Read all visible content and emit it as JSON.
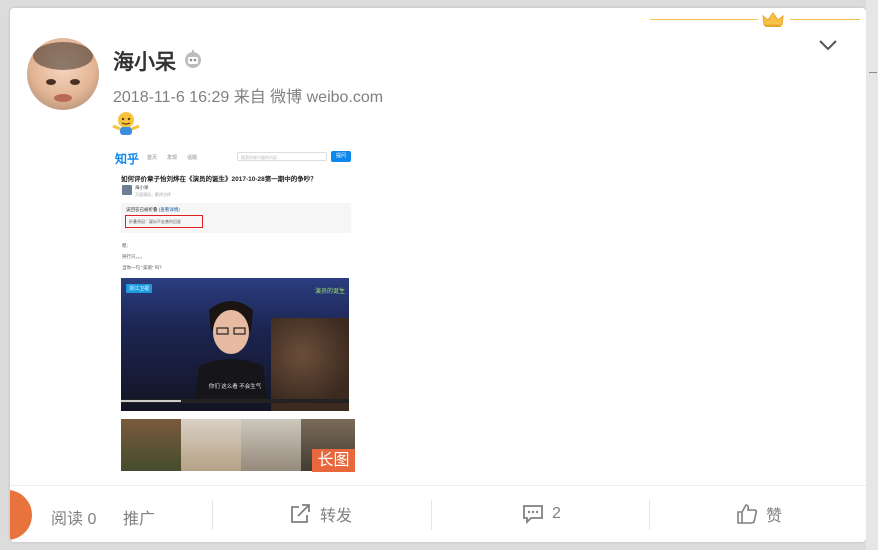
{
  "post": {
    "username": "海小呆",
    "date": "2018-11-6 16:29",
    "source_prefix": "来自",
    "source": "微博 weibo.com",
    "image_badge": "长图"
  },
  "zhihu": {
    "logo": "知乎",
    "nav": [
      "首页",
      "发现",
      "话题"
    ],
    "search_placeholder": "搜索你感兴趣的内容...",
    "ask_button": "提问",
    "question": "如何评价章子怡刘烨在《演员的诞生》2017-10-28第一期中的争吵？",
    "author_name": "海小呆",
    "author_desc": "万恶演员，影评点评",
    "fold_title": "该回答已被折叠",
    "fold_link": "(查看详情)",
    "fold_reason": "折叠原因：疑似不友善的回复",
    "body_lines": [
      "嗯：",
      "哭行只。。。",
      "当你一句 \"美丽\" 吗？"
    ],
    "video_logo": "浙江卫视",
    "video_rt": "演员的诞生",
    "video_caption": "你们 这么看 不会生气"
  },
  "footer": {
    "read_label": "阅读",
    "read_count": "0",
    "promote": "推广",
    "repost": "转发",
    "comment_count": "2",
    "like": "赞"
  },
  "colors": {
    "accent_orange": "#e8673d",
    "crown_gold": "#f3c04a",
    "text_gray": "#808080"
  }
}
